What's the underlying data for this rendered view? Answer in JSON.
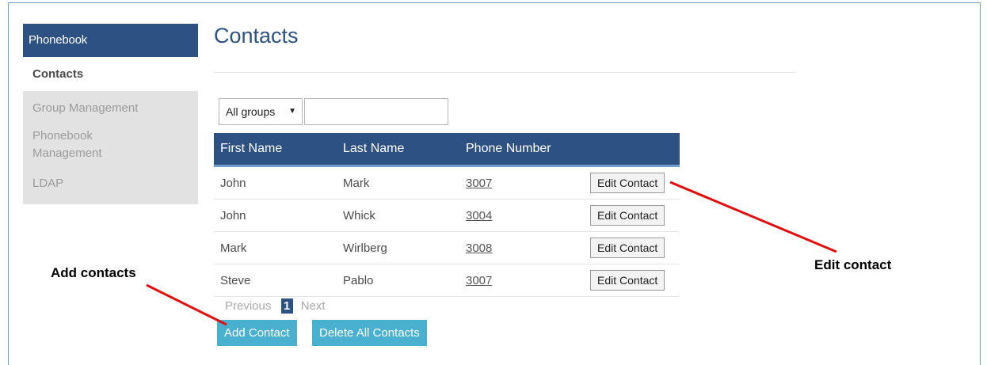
{
  "sidebar": {
    "header": "Phonebook",
    "active_item": "Contacts",
    "items": [
      "Group Management",
      "Phonebook Management",
      "LDAP"
    ]
  },
  "page": {
    "title": "Contacts"
  },
  "filter": {
    "group_selected": "All groups",
    "search_value": ""
  },
  "table": {
    "headers": [
      "First Name",
      "Last Name",
      "Phone Number"
    ],
    "rows": [
      {
        "first": "John",
        "last": "Mark",
        "phone": "3007",
        "action": "Edit Contact"
      },
      {
        "first": "John",
        "last": "Whick",
        "phone": "3004",
        "action": "Edit Contact"
      },
      {
        "first": "Mark",
        "last": "Wirlberg",
        "phone": "3008",
        "action": "Edit Contact"
      },
      {
        "first": "Steve",
        "last": "Pablo",
        "phone": "3007",
        "action": "Edit Contact"
      }
    ]
  },
  "pagination": {
    "previous": "Previous",
    "current_page": "1",
    "next": "Next"
  },
  "actions": {
    "add": "Add Contact",
    "delete_all": "Delete All Contacts"
  },
  "annotations": {
    "add": "Add contacts",
    "edit": "Edit contact"
  },
  "colors": {
    "brand": "#2d5182",
    "button": "#4ab0d0",
    "annotation_arrow": "#e01010"
  }
}
